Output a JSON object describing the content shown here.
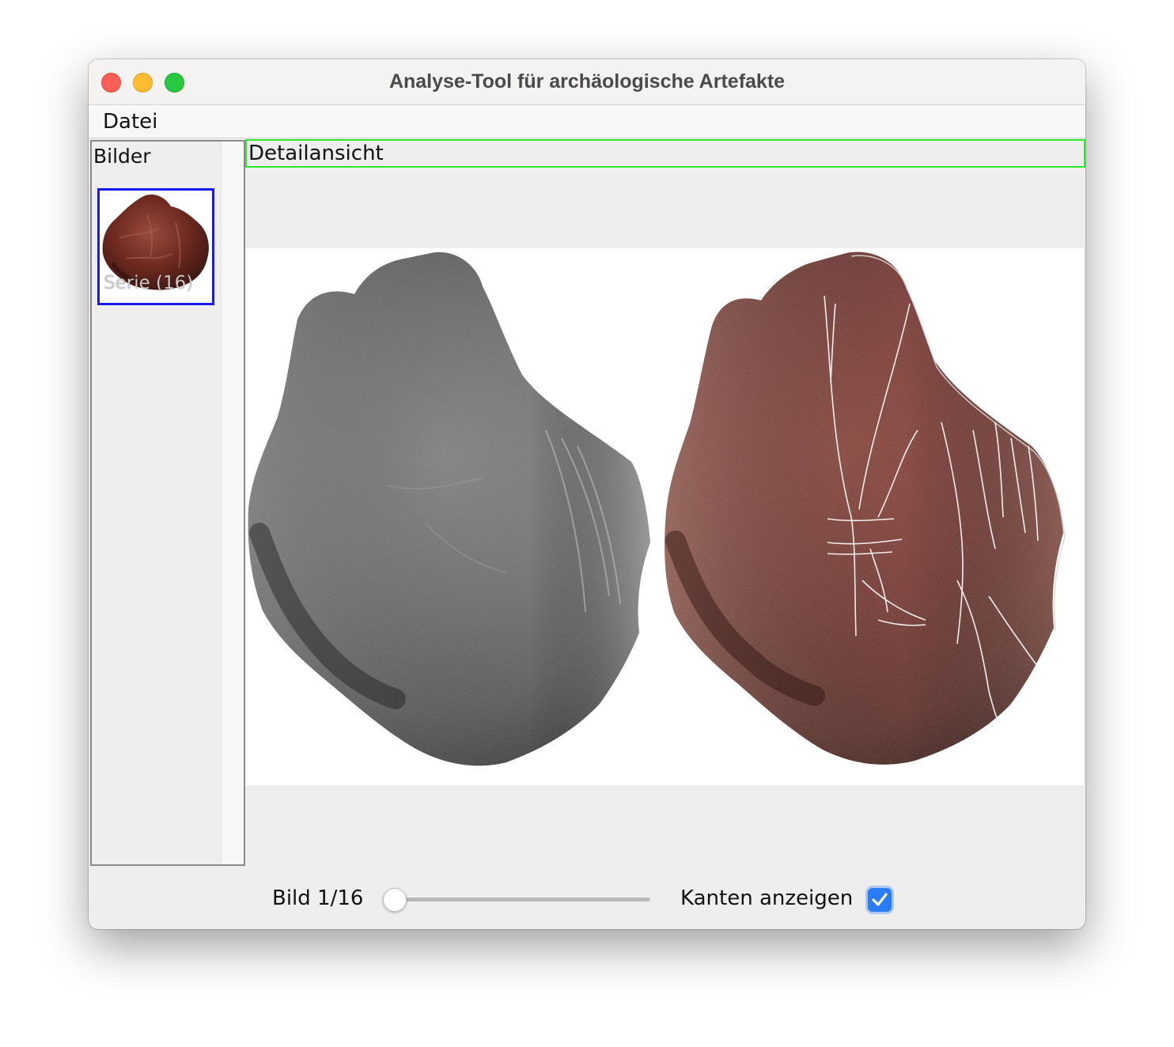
{
  "window": {
    "title": "Analyse-Tool für archäologische Artefakte"
  },
  "menu": {
    "items": [
      "Datei"
    ]
  },
  "sidebar": {
    "title": "Bilder",
    "thumbnails": [
      {
        "label": "Serie (16)",
        "selected": true
      }
    ]
  },
  "detail": {
    "title": "Detailansicht",
    "left_image": "grayscale-relief-artifact",
    "right_image": "color-artifact-with-edge-overlay"
  },
  "controls": {
    "image_label": "Bild 1/16",
    "image_index": 1,
    "image_count": 16,
    "edges_label": "Kanten anzeigen",
    "edges_checked": true
  },
  "colors": {
    "selection_border": "#1a1aee",
    "detail_header_border": "#2ee82e",
    "checkbox_accent": "#2a7cf6",
    "artifact_red": "#7a2f24"
  }
}
